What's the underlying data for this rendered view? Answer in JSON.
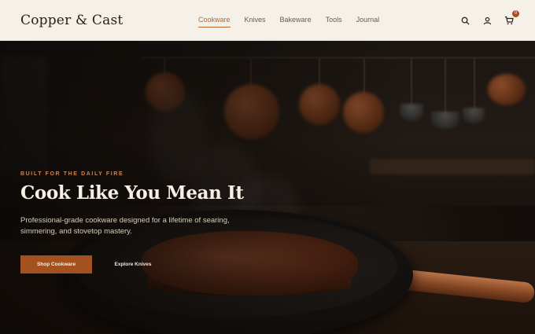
{
  "brand": {
    "logo": "Copper & Cast"
  },
  "nav": {
    "items": [
      {
        "label": "Cookware",
        "active": true
      },
      {
        "label": "Knives",
        "active": false
      },
      {
        "label": "Bakeware",
        "active": false
      },
      {
        "label": "Tools",
        "active": false
      },
      {
        "label": "Journal",
        "active": false
      }
    ]
  },
  "header_icons": {
    "search": "search-icon",
    "account": "user-icon",
    "cart": "cart-icon",
    "cart_count": "0"
  },
  "hero": {
    "eyebrow": "BUILT FOR THE DAILY FIRE",
    "headline": "Cook Like You Mean It",
    "subtext": "Professional-grade cookware designed for a lifetime of searing, simmering, and stovetop mastery.",
    "primary_cta": "Shop Cookware",
    "secondary_cta": "Explore Knives"
  },
  "colors": {
    "accent": "#a3521f",
    "nav_active": "#b8652e",
    "header_bg": "#f6f1e8",
    "hero_text": "#f6efe3"
  }
}
